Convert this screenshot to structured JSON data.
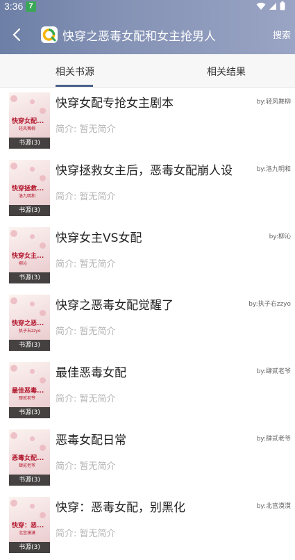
{
  "status_bar": {
    "time": "3:36",
    "notification_badge": "7"
  },
  "toolbar": {
    "title": "快穿之恶毒女配和女主抢男人",
    "search_label": "搜索"
  },
  "tabs": [
    {
      "label": "相关书源",
      "active": true
    },
    {
      "label": "相关结果",
      "active": false
    }
  ],
  "intro_label": "简介: 暂无简介",
  "books": [
    {
      "title": "快穿女配专抢女主剧本",
      "author": "by:轻风舞柳",
      "cover_title": "快穿女配...",
      "cover_author": "轻风舞柳",
      "sources": "书源(3)"
    },
    {
      "title": "快穿拯救女主后，恶毒女配崩人设",
      "author": "by:洛九明和",
      "cover_title": "快穿拯救...",
      "cover_author": "洛九明和",
      "sources": "书源(3)"
    },
    {
      "title": "快穿女主VS女配",
      "author": "by:柳沁",
      "cover_title": "快穿女主...",
      "cover_author": "柳沁",
      "sources": "书源(3)"
    },
    {
      "title": "快穿之恶毒女配觉醒了",
      "author": "by:执子右zzyo",
      "cover_title": "快穿之恶...",
      "cover_author": "执子右zzyo",
      "sources": "书源(3)"
    },
    {
      "title": "最佳恶毒女配",
      "author": "by:肆贰老爷",
      "cover_title": "最佳恶毒...",
      "cover_author": "肆贰老爷",
      "sources": "书源(3)"
    },
    {
      "title": "恶毒女配日常",
      "author": "by:肆贰老爷",
      "cover_title": "恶毒女配...",
      "cover_author": "肆贰老爷",
      "sources": "书源(3)"
    },
    {
      "title": "快穿：恶毒女配，别黑化",
      "author": "by:北宫漠漠",
      "cover_title": "快穿：恶...",
      "cover_author": "北宫漠漠",
      "sources": "书源(3)"
    }
  ]
}
